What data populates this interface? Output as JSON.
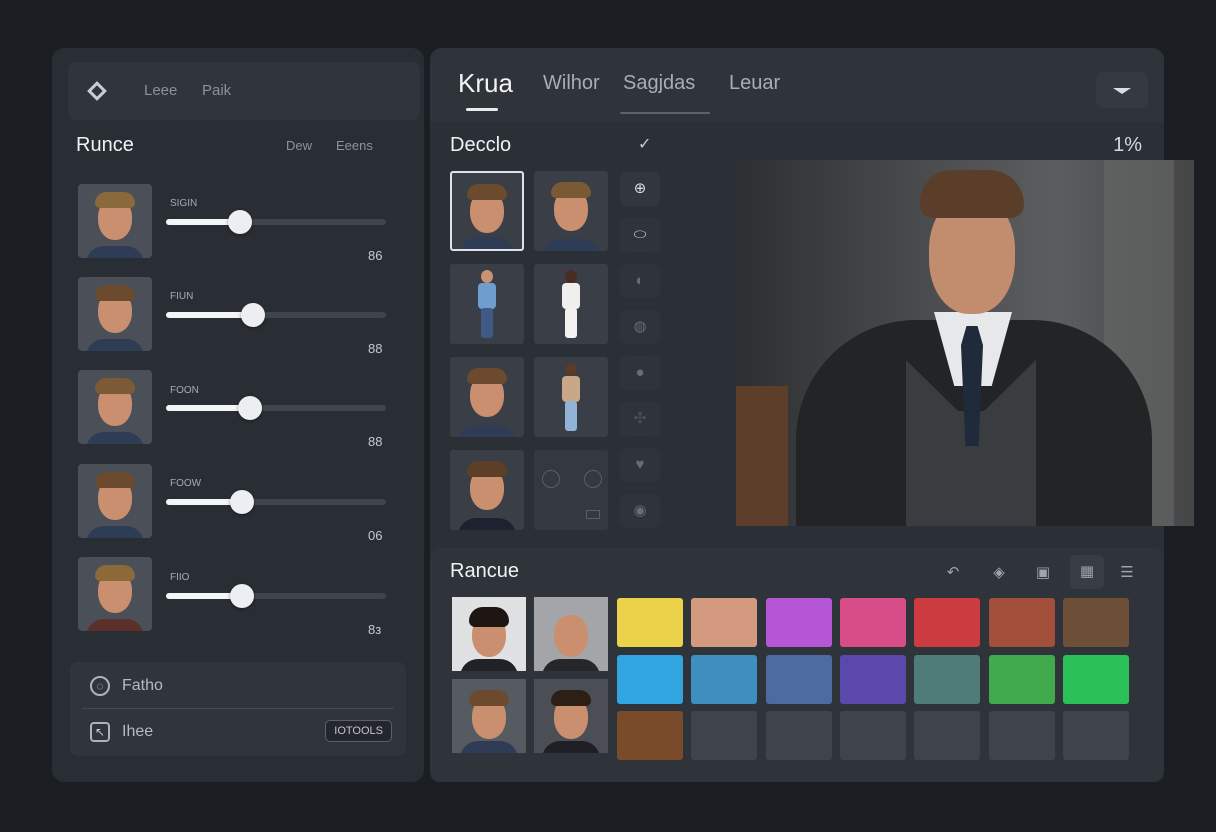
{
  "toolbar": {
    "items": [
      "Leee",
      "Paik"
    ]
  },
  "left": {
    "section_title": "Runce",
    "links": [
      "Dew",
      "Eeens"
    ],
    "sliders": [
      {
        "label": "SIGIN",
        "value": "86",
        "level": 0.37
      },
      {
        "label": "FIUN",
        "value": "88",
        "level": 0.42
      },
      {
        "label": "FOON",
        "value": "88",
        "level": 0.38
      },
      {
        "label": "FOOW",
        "value": "06",
        "level": 0.35
      },
      {
        "label": "FIIO",
        "value": "8з",
        "level": 0.35
      }
    ],
    "actions": [
      {
        "label": "Fatho",
        "icon": "lasso-icon"
      },
      {
        "label": "Ihee",
        "icon": "cursor-icon",
        "badge": "IOTOOLS"
      }
    ]
  },
  "right": {
    "tabs": [
      {
        "label": "Krua",
        "active": true
      },
      {
        "label": "Wilhor",
        "active": false
      },
      {
        "label": "Sagjdas",
        "active": false
      },
      {
        "label": "Leuar",
        "active": false
      }
    ],
    "gallery_title": "Decclo",
    "zoom": "1%",
    "palette_title": "Rancue",
    "swatch_colors": [
      [
        "#ecd24a",
        "#d49a80",
        "#b556d7",
        "#d64d87",
        "#cc3b3f",
        "#a24f3b",
        "#6d5037"
      ],
      [
        "#31a5df",
        "#3e8fc0",
        "#4d6ba1",
        "#5a48aa",
        "#4f7c78",
        "#41aa4d",
        "#2cc158"
      ],
      [
        "#7a4b2a",
        "#3f434b",
        "#3f434b",
        "#3f434b",
        "#3f434b",
        "#3f434b",
        "#3f434b"
      ]
    ],
    "accent": "#e9ebef"
  }
}
